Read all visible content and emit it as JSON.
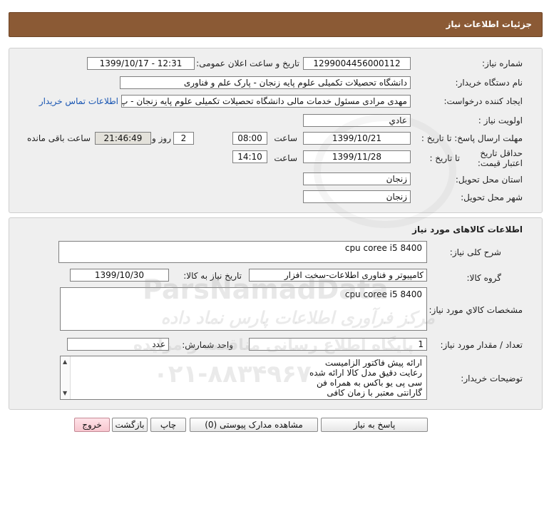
{
  "header": {
    "title": "جزئیات اطلاعات نیاز"
  },
  "need_info": {
    "need_number_label": "شماره نیاز:",
    "need_number": "1299004456000112",
    "announce_label": "تاریخ و ساعت اعلان عمومی:",
    "announce_value": "1399/10/17 - 12:31",
    "buyer_org_label": "نام دستگاه خریدار:",
    "buyer_org": "دانشگاه تحصیلات تکمیلی علوم پایه زنجان - پارک علم و فناوری",
    "requester_label": "ایجاد کننده درخواست:",
    "requester": "مهدی مرادی مسئول خدمات مالی دانشگاه تحصیلات تکمیلی علوم پایه زنجان - پ",
    "contact_link": "اطلاعات تماس خریدار",
    "priority_label": "اولویت نیاز :",
    "priority": "عادي",
    "deadline_label": "مهلت ارسال پاسخ: تا تاریخ :",
    "deadline_date": "1399/10/21",
    "deadline_time_label": "ساعت",
    "deadline_time": "08:00",
    "days_value": "2",
    "days_label": "روز و",
    "remaining_time": "21:46:49",
    "remaining_label": "ساعت باقی مانده",
    "validity_label": "حداقل تاریخ اعتبار قیمت:",
    "validity_to_label": "تا تاریخ :",
    "validity_date": "1399/11/28",
    "validity_time_label": "ساعت",
    "validity_time": "14:10",
    "province_label": "استان محل تحویل:",
    "province": "زنجان",
    "city_label": "شهر محل تحویل:",
    "city": "زنجان"
  },
  "goods": {
    "section_title": "اطلاعات کالاهای مورد نیاز",
    "general_desc_label": "شرح کلی نیاز:",
    "general_desc": "cpu coree i5 8400",
    "group_label": "گروه کالا:",
    "group": "کامپیوتر و فناوری اطلاعات-سخت افزار",
    "need_date_label": "تاریخ نیاز به کالا:",
    "need_date": "1399/10/30",
    "specs_label": "مشخصات کالاي مورد نیاز:",
    "specs": "cpu coree i5 8400",
    "qty_label": "تعداد / مقدار مورد نیاز:",
    "qty": "1",
    "unit_label": "واحد شمارش:",
    "unit": "عدد",
    "buyer_notes_label": "توضیحات خریدار:",
    "buyer_notes": [
      "ارائه پیش فاکتور الزامیست",
      "رعایت دقیق مدل کالا ارائه شده",
      "سی پی یو باکس به همراه فن",
      "گارانتی معتبر با زمان کافی"
    ]
  },
  "buttons": {
    "reply": "پاسخ به نیاز",
    "view_docs": "مشاهده مدارک پیوستی (0)",
    "print": "چاپ",
    "back": "بازگشت",
    "exit": "خروج"
  },
  "watermark": {
    "line1": "ParsNamadData",
    "line2": "مرکز فرآوری اطلاعات پارس نماد داده",
    "line3": "پایگاه اطلاع رسانی مناقصه و مزایده",
    "phone": "۰۲۱-۸۸۳۴۹۶۷۰"
  },
  "colors": {
    "header_bg": "#8b5a35",
    "panel_bg": "#efefef",
    "link": "#1b57b3",
    "exit_button": "#f7c6cf"
  }
}
